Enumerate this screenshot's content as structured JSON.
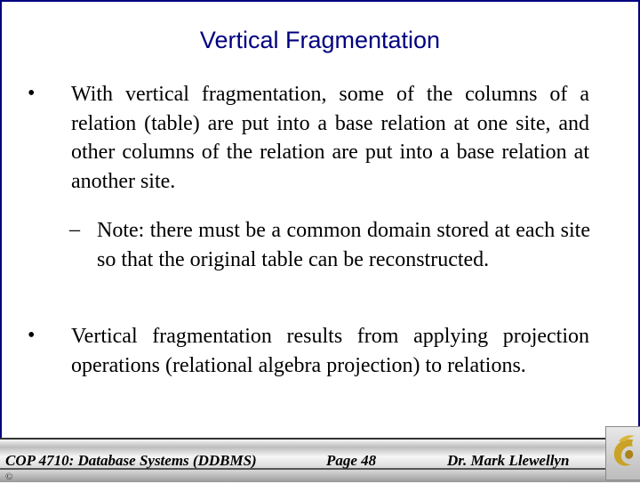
{
  "slide": {
    "title": "Vertical Fragmentation",
    "bullets": [
      {
        "marker": "•",
        "text": "With vertical fragmentation, some of the columns of a relation (table) are put into a base relation at one site, and other columns of the relation are put into a base relation at another site."
      },
      {
        "marker": "–",
        "text": "Note: there must be a common domain stored at each site so that the original table can be reconstructed."
      },
      {
        "marker": "•",
        "text": "Vertical fragmentation results from applying projection operations (relational algebra projection) to relations."
      }
    ]
  },
  "footer": {
    "course": "COP 4710: Database Systems  (DDBMS)",
    "page": "Page 48",
    "author": "Dr. Mark Llewellyn",
    "copyright": "©",
    "logo_icon": "pegasus-logo-icon"
  },
  "colors": {
    "title": "#000080",
    "border": "#000080",
    "logo_gold": "#c9a227"
  }
}
